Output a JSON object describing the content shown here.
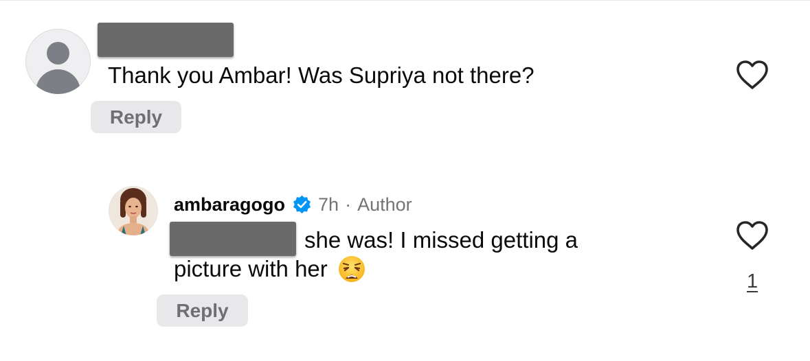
{
  "comments": [
    {
      "author": "",
      "text": "Thank you Ambar! Was Supriya not there?",
      "reply_label": "Reply",
      "icons": {
        "avatar": "default-user-avatar-icon",
        "like": "heart-outline-icon"
      }
    },
    {
      "author": "ambaragogo",
      "verified": true,
      "time": "7h",
      "separator": "·",
      "role": "Author",
      "text_line1": "she was! I missed getting a",
      "text_line2": "picture with her",
      "emoji": "weary-face-emoji",
      "like_count": "1",
      "reply_label": "Reply",
      "icons": {
        "avatar": "profile-photo",
        "like": "heart-outline-icon",
        "badge": "verified-badge-icon"
      }
    }
  ],
  "colors": {
    "verified": "#0095f6",
    "text": "#0a0a0a",
    "meta": "#737373",
    "reply_bg": "#e8e8ea",
    "redaction": "#6a6a6b"
  }
}
